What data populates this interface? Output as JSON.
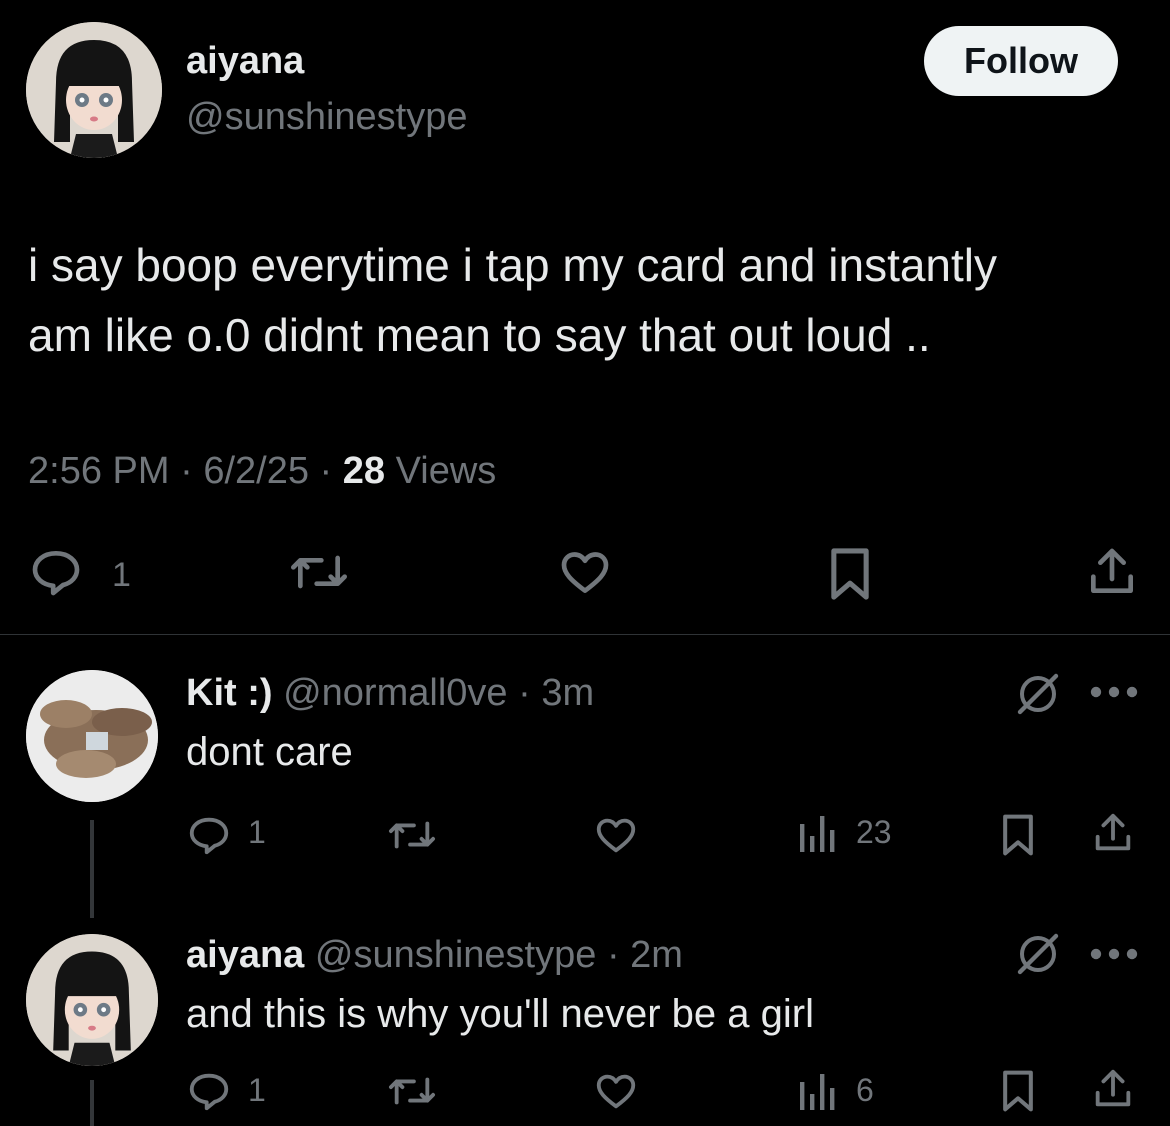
{
  "main_post": {
    "author_name": "aiyana",
    "author_handle": "@sunshinestype",
    "follow_label": "Follow",
    "text_line1": "i say boop everytime i tap my card and instantly",
    "text_line2": "am like o.0 didnt mean to say that out loud ..",
    "time": "2:56 PM",
    "sep1": "·",
    "date": "6/2/25",
    "sep2": "·",
    "views_count": "28",
    "views_label": "Views",
    "reply_count": "1"
  },
  "replies": [
    {
      "author_name": "Kit :)",
      "author_handle": "@normall0ve",
      "sep": "·",
      "age": "3m",
      "text": "dont care",
      "reply_count": "1",
      "views_count": "23"
    },
    {
      "author_name": "aiyana",
      "author_handle": "@sunshinestype",
      "sep": "·",
      "age": "2m",
      "text": "and this is why you'll never be a girl",
      "reply_count": "1",
      "views_count": "6"
    }
  ],
  "colors": {
    "background": "#000000",
    "text_primary": "#e7e9ea",
    "text_secondary": "#71767b",
    "divider": "#2f3336",
    "follow_bg": "#eff3f4"
  }
}
